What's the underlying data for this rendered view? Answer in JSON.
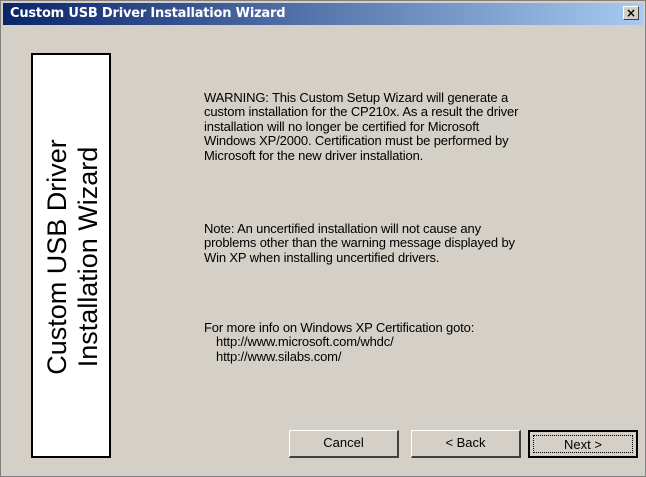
{
  "window": {
    "title": "Custom USB Driver Installation Wizard",
    "close_label": "×"
  },
  "sidebar": {
    "line1": "Custom USB Driver",
    "line2": "Installation Wizard"
  },
  "content": {
    "warning": "WARNING: This Custom Setup Wizard will generate a custom installation for the CP210x. As a result the driver installation will no longer be certified for Microsoft Windows XP/2000. Certification must be performed by Microsoft for the new driver installation.",
    "note": "Note: An uncertified installation will not cause any problems other than the warning message displayed by Win XP when installing uncertified drivers.",
    "info_heading": "For more info on Windows XP Certification goto:",
    "link1": "http://www.microsoft.com/whdc/",
    "link2": "http://www.silabs.com/"
  },
  "buttons": {
    "cancel": "Cancel",
    "back": "< Back",
    "next": "Next >"
  }
}
